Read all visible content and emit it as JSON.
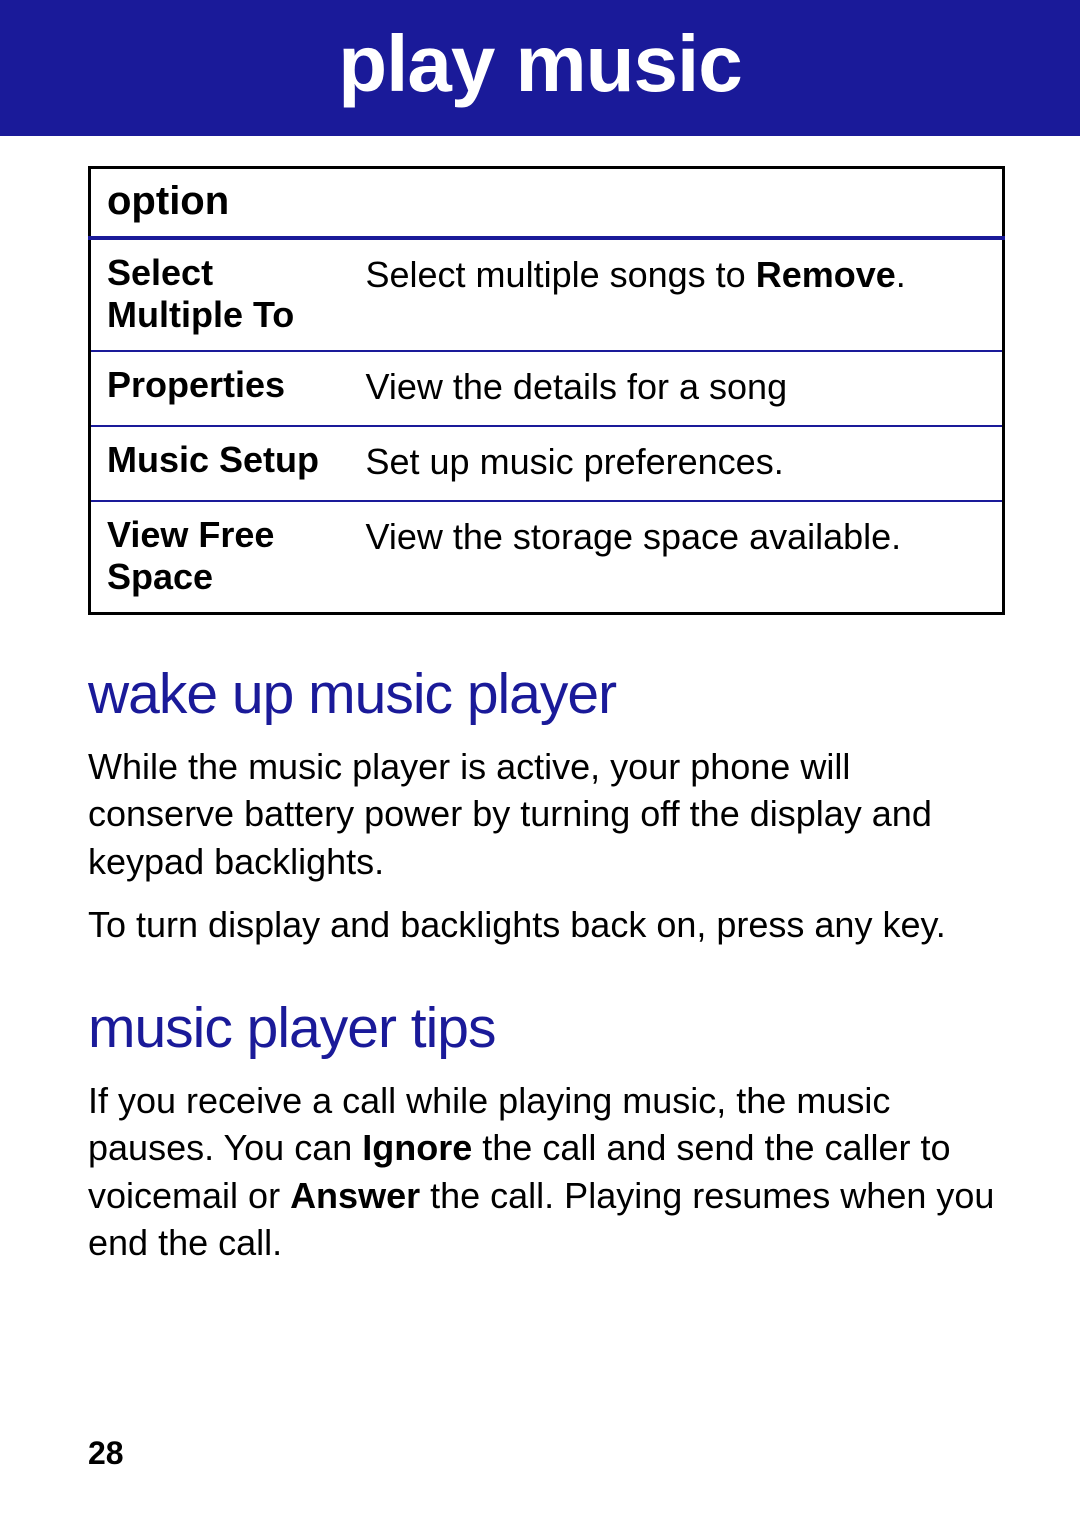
{
  "header": {
    "title": "play music"
  },
  "table": {
    "header": "option",
    "rows": [
      {
        "label": "Select Multiple To",
        "desc_pre": "Select multiple songs to ",
        "desc_bold": "Remove",
        "desc_post": "."
      },
      {
        "label": "Properties",
        "desc_pre": "View the details for a song",
        "desc_bold": "",
        "desc_post": ""
      },
      {
        "label": "Music Setup",
        "desc_pre": "Set up music preferences.",
        "desc_bold": "",
        "desc_post": ""
      },
      {
        "label": "View Free Space",
        "desc_pre": "View the storage space available.",
        "desc_bold": "",
        "desc_post": ""
      }
    ]
  },
  "sections": {
    "wake": {
      "heading": "wake up music player",
      "p1": "While the music player is active, your phone will conserve battery power by turning off the display and keypad backlights.",
      "p2": "To turn display and backlights back on, press any key."
    },
    "tips": {
      "heading": "music player tips",
      "p1_a": "If you receive a call while playing music, the music pauses. You can ",
      "p1_b_bold": "Ignore",
      "p1_c": " the call and send the caller to voicemail or ",
      "p1_d_bold": "Answer",
      "p1_e": " the call. Playing resumes when you end the call."
    }
  },
  "page_number": "28"
}
